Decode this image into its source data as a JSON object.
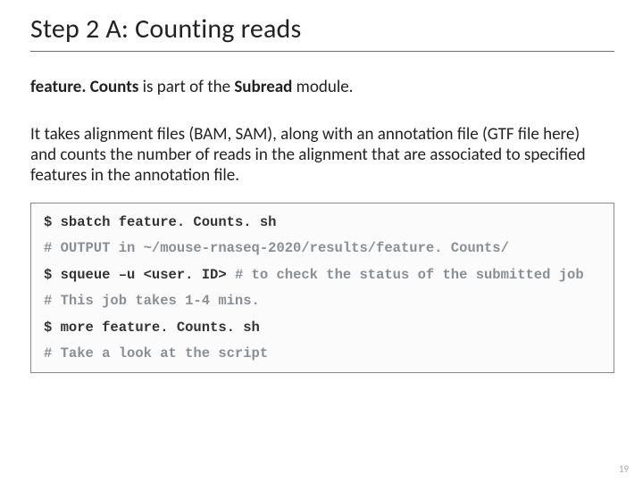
{
  "title": "Step 2 A: Counting reads",
  "lead": {
    "p1_bold": "feature. Counts",
    "p1_rest": "  is part of the ",
    "p1_bold2": "Subread",
    "p1_tail": " module."
  },
  "body": "It takes alignment files (BAM, SAM), along with an annotation file (GTF file here) and counts the number of reads in the alignment that are associated to specified features in the annotation file.",
  "code": {
    "l1_prompt": "$ ",
    "l1_cmd": "sbatch feature. Counts. sh",
    "l2_comment": "# OUTPUT in ~/mouse-rnaseq-2020/results/feature. Counts/",
    "l3_prompt": "$ ",
    "l3_cmd": "squeue –u <user. ID> ",
    "l3_comment": "# to check the status of the submitted job",
    "l4_comment": "# This job takes 1-4 mins.",
    "l5_prompt": "$ ",
    "l5_cmd": "more feature. Counts. sh",
    "l6_comment": "# Take a look at the script"
  },
  "pagenum": "19"
}
